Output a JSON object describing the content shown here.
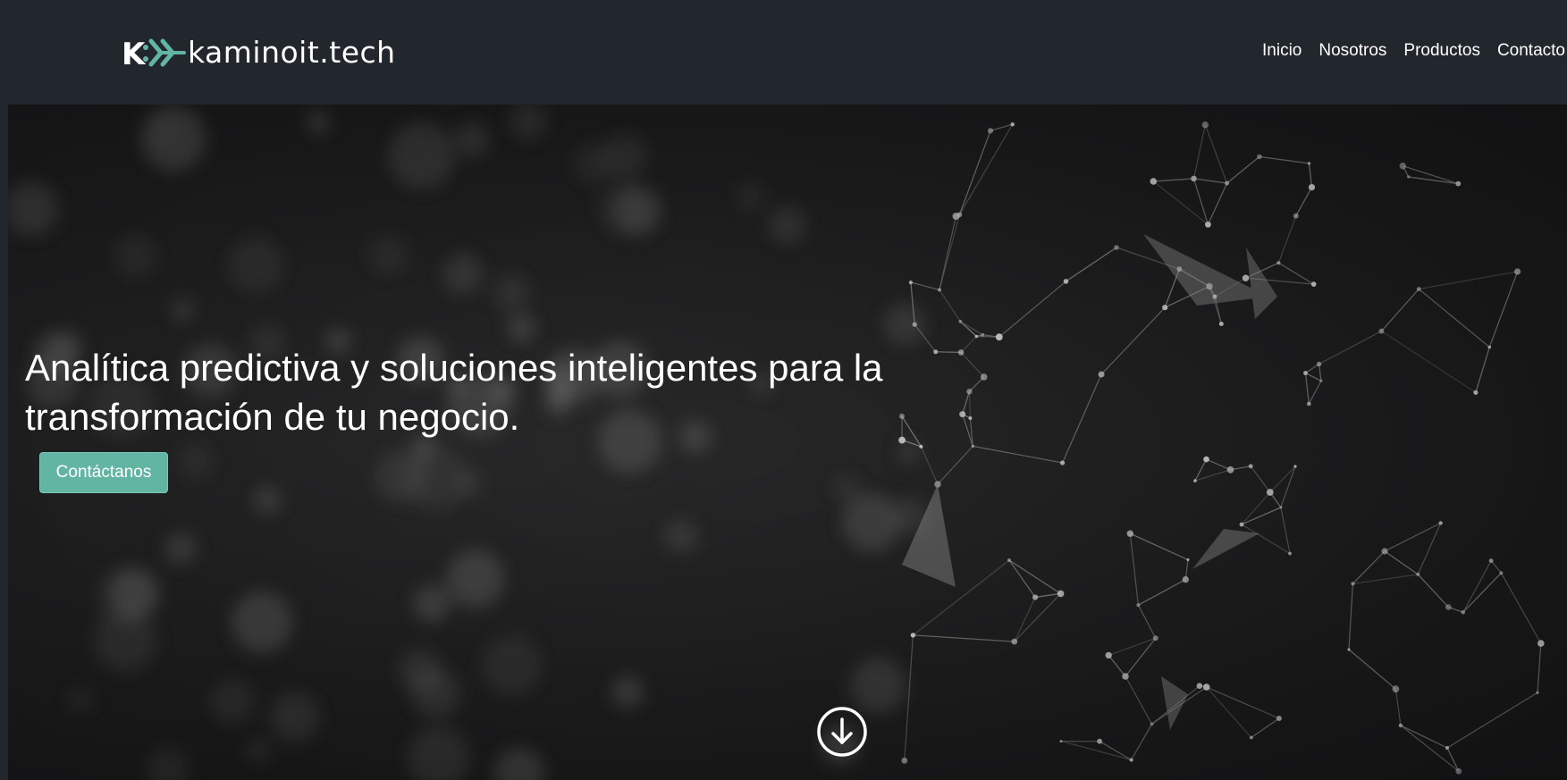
{
  "brand": {
    "name": "kaminoit.tech",
    "mark_letter": "K",
    "accent_color": "#62b5a3"
  },
  "nav": {
    "items": [
      {
        "label": "Inicio"
      },
      {
        "label": "Nosotros"
      },
      {
        "label": "Productos"
      },
      {
        "label": "Contacto"
      }
    ]
  },
  "hero": {
    "headline": "Analítica predictiva y soluciones inteligentes para la transformación de tu negocio.",
    "cta_label": "Contáctanos",
    "scroll_icon": "arrow-down-circle-icon",
    "background": "network-particles-image"
  }
}
